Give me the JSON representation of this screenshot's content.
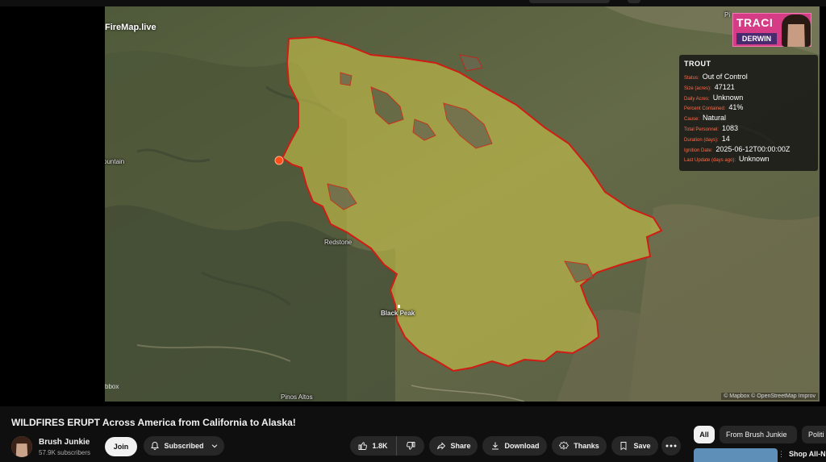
{
  "video": {
    "title": "WILDFIRES ERUPT Across America from California to Alaska!"
  },
  "map": {
    "brand": "FireMap.live",
    "places": {
      "mountain": "ountain",
      "redstone": "Redstone",
      "black_peak": "Black Peak",
      "pinos_altos": "Pinos Altos",
      "top_right": "Pi"
    },
    "attribution": "© Mapbox © OpenStreetMap  Improv",
    "box_label": "bbox",
    "colors": {
      "fire_fill": "#c9c34a",
      "fire_border": "#d01c14",
      "ignition_dot": "#ff4d1a",
      "terrain": "#5b6240"
    }
  },
  "presenter": {
    "first": "TRACI",
    "last": "DERWIN"
  },
  "fire_info": {
    "name": "TROUT",
    "fields": [
      {
        "key": "Status:",
        "value": "Out of Control"
      },
      {
        "key": "Size (acres):",
        "value": "47121"
      },
      {
        "key": "Daily Acres:",
        "value": "Unknown"
      },
      {
        "key": "Percent Contained:",
        "value": "41%"
      },
      {
        "key": "Cause:",
        "value": "Natural"
      },
      {
        "key": "Total Personnel:",
        "value": "1083"
      },
      {
        "key": "Duration (days):",
        "value": "14"
      },
      {
        "key": "Ignition Date:",
        "value": "2025-06-12T00:00:00Z"
      },
      {
        "key": "Last Update (days ago):",
        "value": "Unknown"
      }
    ]
  },
  "channel": {
    "name": "Brush Junkie",
    "subscribers": "57.9K subscribers",
    "join_label": "Join",
    "subscribed_label": "Subscribed"
  },
  "actions": {
    "likes": "1.8K",
    "share": "Share",
    "download": "Download",
    "thanks": "Thanks",
    "save": "Save"
  },
  "chips": [
    "All",
    "From Brush Junkie",
    "Politi"
  ],
  "recommended": {
    "title": "Shop All-N",
    "more": "⋮"
  }
}
